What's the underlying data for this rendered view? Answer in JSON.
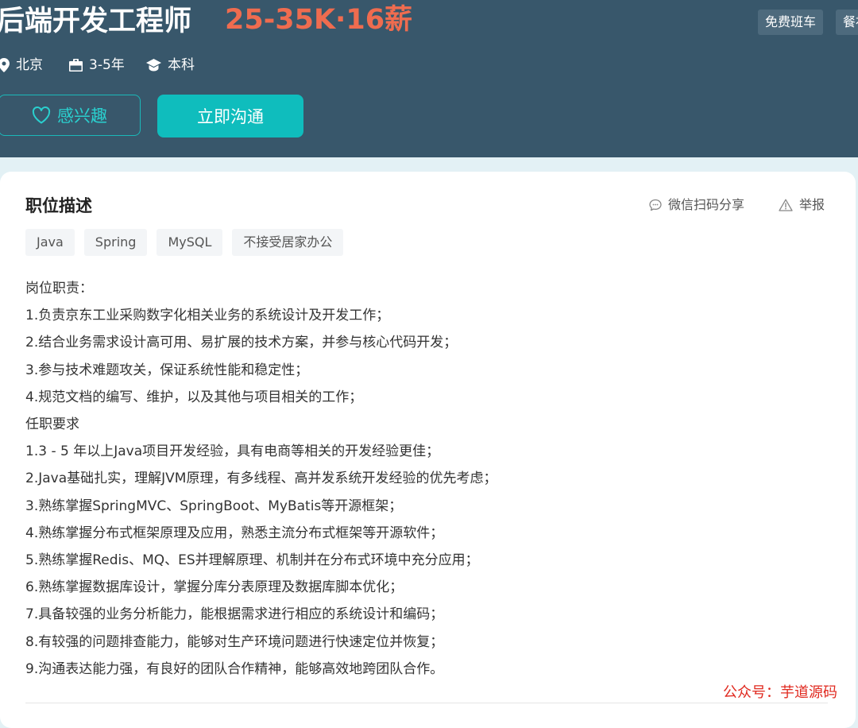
{
  "job": {
    "title": "后端开发工程师",
    "salary": "25-35K·16薪",
    "benefits": [
      "免费班车",
      "餐补"
    ],
    "location": "北京",
    "experience": "3-5年",
    "education": "本科",
    "location_icon": "location-pin-icon",
    "experience_icon": "briefcase-icon",
    "education_icon": "graduation-cap-icon"
  },
  "actions": {
    "interest_label": "感兴趣",
    "chat_label": "立即沟通",
    "interest_icon": "heart-icon"
  },
  "description": {
    "title": "职位描述",
    "share_label": "微信扫码分享",
    "report_label": "举报",
    "share_icon": "chat-bubble-icon",
    "report_icon": "warning-triangle-icon",
    "tags": [
      "Java",
      "Spring",
      "MySQL",
      "不接受居家办公"
    ],
    "lines": [
      "岗位职责：",
      "1.负责京东工业采购数字化相关业务的系统设计及开发工作；",
      "2.结合业务需求设计高可用、易扩展的技术方案，并参与核心代码开发；",
      "3.参与技术难题攻关，保证系统性能和稳定性；",
      "4.规范文档的编写、维护，以及其他与项目相关的工作；",
      "任职要求",
      "1.3 - 5 年以上Java项目开发经验，具有电商等相关的开发经验更佳；",
      "2.Java基础扎实，理解JVM原理，有多线程、高并发系统开发经验的优先考虑；",
      "3.熟练掌握SpringMVC、SpringBoot、MyBatis等开源框架；",
      "4.熟练掌握分布式框架原理及应用，熟悉主流分布式框架等开源软件；",
      "5.熟练掌握Redis、MQ、ES并理解原理、机制并在分布式环境中充分应用；",
      "6.熟练掌握数据库设计，掌握分库分表原理及数据库脚本优化；",
      "7.具备较强的业务分析能力，能根据需求进行相应的系统设计和编码；",
      "8.有较强的问题排查能力，能够对生产环境问题进行快速定位并恢复；",
      "9.沟通表达能力强，有良好的团队合作精神，能够高效地跨团队合作。"
    ]
  },
  "watermark": "公众号：芋道源码",
  "colors": {
    "header_bg": "#38576b",
    "salary": "#ef6c4f",
    "accent": "#0fbdbd",
    "watermark": "#e0291f"
  }
}
